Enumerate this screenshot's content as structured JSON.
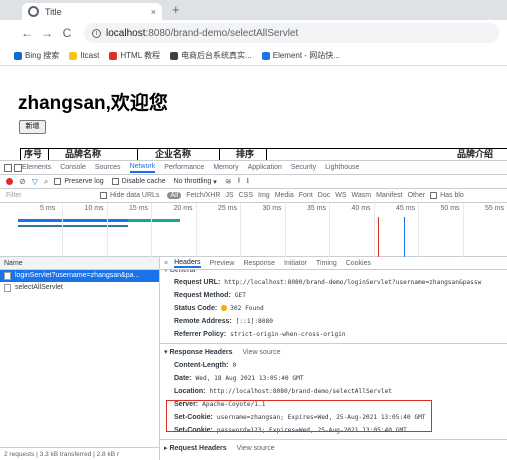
{
  "browser": {
    "tab_title": "Title",
    "tab_close": "×",
    "new_tab": "+",
    "nav": {
      "back": "←",
      "forward": "→",
      "reload": "C"
    },
    "url_host": "localhost",
    "url_path": ":8080/brand-demo/selectAllServlet",
    "bookmarks": [
      {
        "label": "Bing 搜索",
        "color": "#0b6fc9"
      },
      {
        "label": "Itcast",
        "color": "#f5c518"
      },
      {
        "label": "HTML 教程",
        "color": "#d93025"
      },
      {
        "label": "电商后台系统真实...",
        "color": "#3c4043"
      },
      {
        "label": "Element - 网站快...",
        "color": "#1a73e8"
      }
    ]
  },
  "page": {
    "greeting": "zhangsan,欢迎您",
    "add_button": "新增",
    "table_headers": [
      "序号",
      "品牌名称",
      "企业名称",
      "排序",
      "品牌介绍"
    ]
  },
  "devtools": {
    "tabs": [
      "Elements",
      "Console",
      "Sources",
      "Network",
      "Performance",
      "Memory",
      "Application",
      "Security",
      "Lighthouse"
    ],
    "active_tab": "Network",
    "toolbar": {
      "preserve_log": "Preserve log",
      "disable_cache": "Disable cache",
      "throttle": "No throttling"
    },
    "filter": {
      "placeholder": "Filter",
      "hide_data_urls": "Hide data URLs",
      "types": [
        "All",
        "Fetch/XHR",
        "JS",
        "CSS",
        "Img",
        "Media",
        "Font",
        "Doc",
        "WS",
        "Wasm",
        "Manifest",
        "Other"
      ],
      "has_blocked": "Has blo"
    },
    "timeline_ticks": [
      "5 ms",
      "10 ms",
      "15 ms",
      "20 ms",
      "25 ms",
      "30 ms",
      "35 ms",
      "40 ms",
      "45 ms",
      "50 ms",
      "55 ms"
    ],
    "list": {
      "header": "Name",
      "requests": [
        "loginServlet?username=zhangsan&pa...",
        "selectAllServlet"
      ],
      "status": "2 requests | 3.3 kB transferred | 2.8 kB r"
    },
    "detail": {
      "tabs": [
        "Headers",
        "Preview",
        "Response",
        "Initiator",
        "Timing",
        "Cookies"
      ],
      "active_tab": "Headers",
      "general_label": "▾ General",
      "general": [
        {
          "key": "Request URL:",
          "value": "http://localhost:8080/brand-demo/loginServlet?username=zhangsan&passw"
        },
        {
          "key": "Request Method:",
          "value": "GET"
        },
        {
          "key": "Status Code:",
          "value": "302 Found"
        },
        {
          "key": "Remote Address:",
          "value": "[::1]:8080"
        },
        {
          "key": "Referrer Policy:",
          "value": "strict-origin-when-cross-origin"
        }
      ],
      "response_label": "▾ Response Headers",
      "request_label": "▸ Request Headers",
      "view_source": "View source",
      "response": [
        {
          "key": "Content-Length:",
          "value": "0"
        },
        {
          "key": "Date:",
          "value": "Wed, 18 Aug 2021 13:05:40 GMT"
        },
        {
          "key": "Location:",
          "value": "http://localhost:8080/brand-demo/selectAllServlet"
        },
        {
          "key": "Server:",
          "value": "Apache-Coyote/1.1"
        },
        {
          "key": "Set-Cookie:",
          "value": "username=zhangsan; Expires=Wed, 25-Aug-2021 13:05:40 GMT"
        },
        {
          "key": "Set-Cookie:",
          "value": "password=123; Expires=Wed, 25-Aug-2021 13:05:40 GMT"
        }
      ]
    }
  }
}
